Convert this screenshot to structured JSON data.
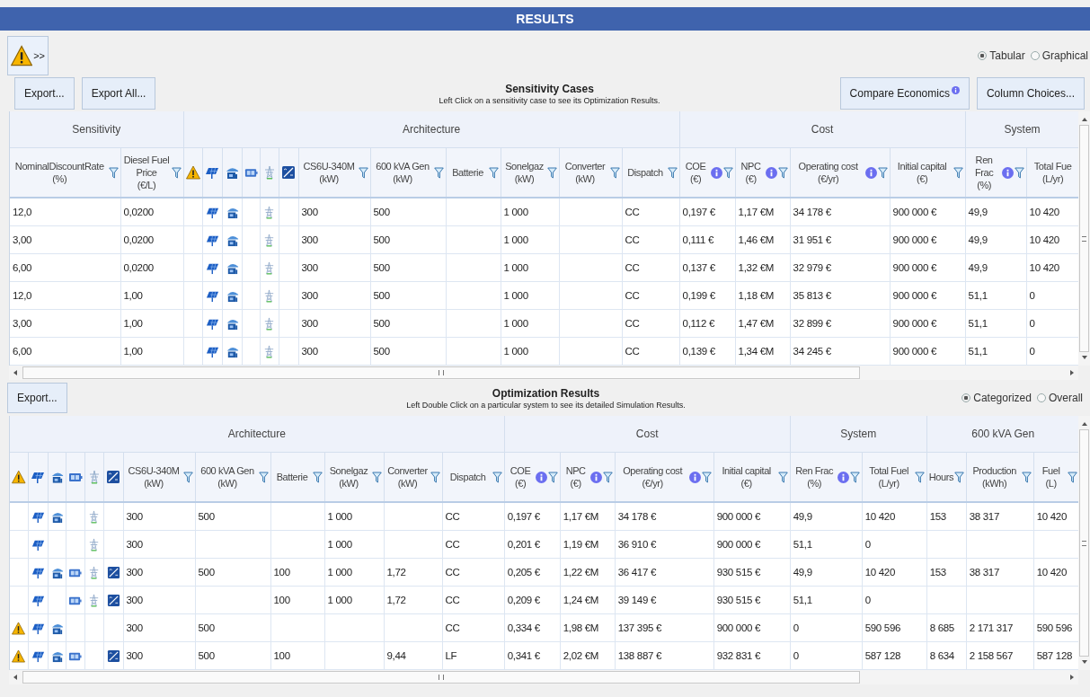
{
  "header": {
    "title": "RESULTS"
  },
  "warning_button": {
    "label": ">>"
  },
  "view_options": [
    {
      "label": "Tabular",
      "selected": true
    },
    {
      "label": "Graphical",
      "selected": false
    }
  ],
  "sensitivity": {
    "left_buttons": [
      "Export...",
      "Export All..."
    ],
    "title": "Sensitivity Cases",
    "hint": "Left Click on a sensitivity case to see its Optimization Results.",
    "right_buttons": [
      {
        "label": "Compare Economics",
        "info": true
      },
      {
        "label": "Column Choices...",
        "info": false
      }
    ],
    "groups": [
      {
        "label": "Sensitivity",
        "columns": [
          {
            "kind": "text",
            "label": "NominalDiscountRate",
            "unit": "(%)",
            "info": false,
            "filter": true
          },
          {
            "kind": "text",
            "label": "Diesel Fuel Price",
            "unit": "(€/L)",
            "info": false,
            "filter": true
          }
        ]
      },
      {
        "label": "Architecture",
        "columns": [
          {
            "kind": "warning",
            "info": false,
            "filter": false
          },
          {
            "kind": "panel",
            "info": false,
            "filter": false
          },
          {
            "kind": "generator",
            "info": false,
            "filter": false
          },
          {
            "kind": "battery",
            "info": false,
            "filter": false
          },
          {
            "kind": "tower",
            "info": false,
            "filter": false
          },
          {
            "kind": "converter",
            "info": false,
            "filter": false
          },
          {
            "kind": "text",
            "label": "CS6U-340M",
            "unit": "(kW)",
            "info": false,
            "filter": true
          },
          {
            "kind": "text",
            "label": "600 kVA Gen",
            "unit": "(kW)",
            "info": false,
            "filter": true
          },
          {
            "kind": "text",
            "label": "Batterie",
            "info": false,
            "filter": true
          },
          {
            "kind": "text",
            "label": "Sonelgaz",
            "unit": "(kW)",
            "info": false,
            "filter": true
          },
          {
            "kind": "text",
            "label": "Converter",
            "unit": "(kW)",
            "info": false,
            "filter": true
          },
          {
            "kind": "text",
            "label": "Dispatch",
            "info": false,
            "filter": true
          }
        ]
      },
      {
        "label": "Cost",
        "columns": [
          {
            "kind": "text",
            "label": "COE",
            "unit": "(€)",
            "info": true,
            "filter": true
          },
          {
            "kind": "text",
            "label": "NPC",
            "unit": "(€)",
            "info": true,
            "filter": true
          },
          {
            "kind": "text",
            "label": "Operating cost",
            "unit": "(€/yr)",
            "info": true,
            "filter": true
          },
          {
            "kind": "text",
            "label": "Initial capital",
            "unit": "(€)",
            "info": false,
            "filter": true
          }
        ]
      },
      {
        "label": "System",
        "columns": [
          {
            "kind": "text",
            "label": "Ren Frac",
            "unit": "(%)",
            "info": true,
            "filter": true
          },
          {
            "kind": "text",
            "label": "Total Fue",
            "unit": "(L/yr)",
            "info": false,
            "filter": false
          }
        ]
      }
    ],
    "rows": [
      {
        "cells": [
          {
            "kind": "text",
            "text": "12,0"
          },
          {
            "kind": "text",
            "text": "0,0200"
          },
          {
            "kind": "icon",
            "shown": false
          },
          {
            "kind": "icon",
            "shown": true
          },
          {
            "kind": "icon",
            "shown": true
          },
          {
            "kind": "icon",
            "shown": false
          },
          {
            "kind": "icon",
            "shown": true
          },
          {
            "kind": "icon",
            "shown": false
          },
          {
            "kind": "text",
            "text": "300"
          },
          {
            "kind": "text",
            "text": "500"
          },
          {
            "kind": "empty"
          },
          {
            "kind": "text",
            "text": "1 000"
          },
          {
            "kind": "empty"
          },
          {
            "kind": "text",
            "text": "CC"
          },
          {
            "kind": "text",
            "text": "0,197 €"
          },
          {
            "kind": "text",
            "text": "1,17 €M"
          },
          {
            "kind": "text",
            "text": "34 178 €"
          },
          {
            "kind": "text",
            "text": "900 000 €"
          },
          {
            "kind": "text",
            "text": "49,9"
          },
          {
            "kind": "text",
            "text": "10 420"
          }
        ]
      },
      {
        "cells": [
          {
            "kind": "text",
            "text": "3,00"
          },
          {
            "kind": "text",
            "text": "0,0200"
          },
          {
            "kind": "icon",
            "shown": false
          },
          {
            "kind": "icon",
            "shown": true
          },
          {
            "kind": "icon",
            "shown": true
          },
          {
            "kind": "icon",
            "shown": false
          },
          {
            "kind": "icon",
            "shown": true
          },
          {
            "kind": "icon",
            "shown": false
          },
          {
            "kind": "text",
            "text": "300"
          },
          {
            "kind": "text",
            "text": "500"
          },
          {
            "kind": "empty"
          },
          {
            "kind": "text",
            "text": "1 000"
          },
          {
            "kind": "empty"
          },
          {
            "kind": "text",
            "text": "CC"
          },
          {
            "kind": "text",
            "text": "0,111 €"
          },
          {
            "kind": "text",
            "text": "1,46 €M"
          },
          {
            "kind": "text",
            "text": "31 951 €"
          },
          {
            "kind": "text",
            "text": "900 000 €"
          },
          {
            "kind": "text",
            "text": "49,9"
          },
          {
            "kind": "text",
            "text": "10 420"
          }
        ]
      },
      {
        "cells": [
          {
            "kind": "text",
            "text": "6,00"
          },
          {
            "kind": "text",
            "text": "0,0200"
          },
          {
            "kind": "icon",
            "shown": false
          },
          {
            "kind": "icon",
            "shown": true
          },
          {
            "kind": "icon",
            "shown": true
          },
          {
            "kind": "icon",
            "shown": false
          },
          {
            "kind": "icon",
            "shown": true
          },
          {
            "kind": "icon",
            "shown": false
          },
          {
            "kind": "text",
            "text": "300"
          },
          {
            "kind": "text",
            "text": "500"
          },
          {
            "kind": "empty"
          },
          {
            "kind": "text",
            "text": "1 000"
          },
          {
            "kind": "empty"
          },
          {
            "kind": "text",
            "text": "CC"
          },
          {
            "kind": "text",
            "text": "0,137 €"
          },
          {
            "kind": "text",
            "text": "1,32 €M"
          },
          {
            "kind": "text",
            "text": "32 979 €"
          },
          {
            "kind": "text",
            "text": "900 000 €"
          },
          {
            "kind": "text",
            "text": "49,9"
          },
          {
            "kind": "text",
            "text": "10 420"
          }
        ]
      },
      {
        "cells": [
          {
            "kind": "text",
            "text": "12,0"
          },
          {
            "kind": "text",
            "text": "1,00"
          },
          {
            "kind": "icon",
            "shown": false
          },
          {
            "kind": "icon",
            "shown": true
          },
          {
            "kind": "icon",
            "shown": true
          },
          {
            "kind": "icon",
            "shown": false
          },
          {
            "kind": "icon",
            "shown": true
          },
          {
            "kind": "icon",
            "shown": false
          },
          {
            "kind": "text",
            "text": "300"
          },
          {
            "kind": "text",
            "text": "500"
          },
          {
            "kind": "empty"
          },
          {
            "kind": "text",
            "text": "1 000"
          },
          {
            "kind": "empty"
          },
          {
            "kind": "text",
            "text": "CC"
          },
          {
            "kind": "text",
            "text": "0,199 €"
          },
          {
            "kind": "text",
            "text": "1,18 €M"
          },
          {
            "kind": "text",
            "text": "35 813 €"
          },
          {
            "kind": "text",
            "text": "900 000 €"
          },
          {
            "kind": "text",
            "text": "51,1"
          },
          {
            "kind": "text",
            "text": "0"
          }
        ]
      },
      {
        "cells": [
          {
            "kind": "text",
            "text": "3,00"
          },
          {
            "kind": "text",
            "text": "1,00"
          },
          {
            "kind": "icon",
            "shown": false
          },
          {
            "kind": "icon",
            "shown": true
          },
          {
            "kind": "icon",
            "shown": true
          },
          {
            "kind": "icon",
            "shown": false
          },
          {
            "kind": "icon",
            "shown": true
          },
          {
            "kind": "icon",
            "shown": false
          },
          {
            "kind": "text",
            "text": "300"
          },
          {
            "kind": "text",
            "text": "500"
          },
          {
            "kind": "empty"
          },
          {
            "kind": "text",
            "text": "1 000"
          },
          {
            "kind": "empty"
          },
          {
            "kind": "text",
            "text": "CC"
          },
          {
            "kind": "text",
            "text": "0,112 €"
          },
          {
            "kind": "text",
            "text": "1,47 €M"
          },
          {
            "kind": "text",
            "text": "32 899 €"
          },
          {
            "kind": "text",
            "text": "900 000 €"
          },
          {
            "kind": "text",
            "text": "51,1"
          },
          {
            "kind": "text",
            "text": "0"
          }
        ]
      },
      {
        "cells": [
          {
            "kind": "text",
            "text": "6,00"
          },
          {
            "kind": "text",
            "text": "1,00"
          },
          {
            "kind": "icon",
            "shown": false
          },
          {
            "kind": "icon",
            "shown": true
          },
          {
            "kind": "icon",
            "shown": true
          },
          {
            "kind": "icon",
            "shown": false
          },
          {
            "kind": "icon",
            "shown": true
          },
          {
            "kind": "icon",
            "shown": false
          },
          {
            "kind": "text",
            "text": "300"
          },
          {
            "kind": "text",
            "text": "500"
          },
          {
            "kind": "empty"
          },
          {
            "kind": "text",
            "text": "1 000"
          },
          {
            "kind": "empty"
          },
          {
            "kind": "text",
            "text": "CC"
          },
          {
            "kind": "text",
            "text": "0,139 €"
          },
          {
            "kind": "text",
            "text": "1,34 €M"
          },
          {
            "kind": "text",
            "text": "34 245 €"
          },
          {
            "kind": "text",
            "text": "900 000 €"
          },
          {
            "kind": "text",
            "text": "51,1"
          },
          {
            "kind": "text",
            "text": "0"
          }
        ]
      }
    ]
  },
  "optimization": {
    "left_buttons": [
      "Export..."
    ],
    "title": "Optimization Results",
    "hint": "Left Double Click on a particular system to see its detailed Simulation Results.",
    "view_options": [
      {
        "label": "Categorized",
        "selected": true
      },
      {
        "label": "Overall",
        "selected": false
      }
    ],
    "groups": [
      {
        "label": "Architecture",
        "columns": [
          {
            "kind": "warning",
            "info": false,
            "filter": false
          },
          {
            "kind": "panel",
            "info": false,
            "filter": false
          },
          {
            "kind": "generator",
            "info": false,
            "filter": false
          },
          {
            "kind": "battery",
            "info": false,
            "filter": false
          },
          {
            "kind": "tower",
            "info": false,
            "filter": false
          },
          {
            "kind": "converter",
            "info": false,
            "filter": false
          },
          {
            "kind": "text",
            "label": "CS6U-340M",
            "unit": "(kW)",
            "info": false,
            "filter": true
          },
          {
            "kind": "text",
            "label": "600 kVA Gen",
            "unit": "(kW)",
            "info": false,
            "filter": true
          },
          {
            "kind": "text",
            "label": "Batterie",
            "info": false,
            "filter": true
          },
          {
            "kind": "text",
            "label": "Sonelgaz",
            "unit": "(kW)",
            "info": false,
            "filter": true
          },
          {
            "kind": "text",
            "label": "Converter",
            "unit": "(kW)",
            "info": false,
            "filter": true
          },
          {
            "kind": "text",
            "label": "Dispatch",
            "info": false,
            "filter": true
          }
        ]
      },
      {
        "label": "Cost",
        "columns": [
          {
            "kind": "text",
            "label": "COE",
            "unit": "(€)",
            "info": true,
            "filter": true
          },
          {
            "kind": "text",
            "label": "NPC",
            "unit": "(€)",
            "info": true,
            "filter": true
          },
          {
            "kind": "text",
            "label": "Operating cost",
            "unit": "(€/yr)",
            "info": true,
            "filter": true
          },
          {
            "kind": "text",
            "label": "Initial capital",
            "unit": "(€)",
            "info": false,
            "filter": true
          }
        ]
      },
      {
        "label": "System",
        "columns": [
          {
            "kind": "text",
            "label": "Ren Frac",
            "unit": "(%)",
            "info": true,
            "filter": true
          },
          {
            "kind": "text",
            "label": "Total Fuel",
            "unit": "(L/yr)",
            "info": false,
            "filter": true
          }
        ]
      },
      {
        "label": "600 kVA Gen",
        "columns": [
          {
            "kind": "text",
            "label": "Hours",
            "info": false,
            "filter": true
          },
          {
            "kind": "text",
            "label": "Production",
            "unit": "(kWh)",
            "info": false,
            "filter": true
          },
          {
            "kind": "text",
            "label": "Fuel",
            "unit": "(L)",
            "info": false,
            "filter": true
          }
        ]
      }
    ],
    "rows": [
      {
        "cells": [
          {
            "kind": "icon",
            "shown": false
          },
          {
            "kind": "icon",
            "shown": true
          },
          {
            "kind": "icon",
            "shown": true
          },
          {
            "kind": "icon",
            "shown": false
          },
          {
            "kind": "icon",
            "shown": true
          },
          {
            "kind": "icon",
            "shown": false
          },
          {
            "kind": "text",
            "text": "300"
          },
          {
            "kind": "text",
            "text": "500"
          },
          {
            "kind": "empty"
          },
          {
            "kind": "text",
            "text": "1 000"
          },
          {
            "kind": "empty"
          },
          {
            "kind": "text",
            "text": "CC"
          },
          {
            "kind": "text",
            "text": "0,197 €"
          },
          {
            "kind": "text",
            "text": "1,17 €M"
          },
          {
            "kind": "text",
            "text": "34 178 €"
          },
          {
            "kind": "text",
            "text": "900 000 €"
          },
          {
            "kind": "text",
            "text": "49,9"
          },
          {
            "kind": "text",
            "text": "10 420"
          },
          {
            "kind": "text",
            "text": "153"
          },
          {
            "kind": "text",
            "text": "38 317"
          },
          {
            "kind": "text",
            "text": "10 420"
          }
        ]
      },
      {
        "cells": [
          {
            "kind": "icon",
            "shown": false
          },
          {
            "kind": "icon",
            "shown": true
          },
          {
            "kind": "icon",
            "shown": false
          },
          {
            "kind": "icon",
            "shown": false
          },
          {
            "kind": "icon",
            "shown": true
          },
          {
            "kind": "icon",
            "shown": false
          },
          {
            "kind": "text",
            "text": "300"
          },
          {
            "kind": "empty"
          },
          {
            "kind": "empty"
          },
          {
            "kind": "text",
            "text": "1 000"
          },
          {
            "kind": "empty"
          },
          {
            "kind": "text",
            "text": "CC"
          },
          {
            "kind": "text",
            "text": "0,201 €"
          },
          {
            "kind": "text",
            "text": "1,19 €M"
          },
          {
            "kind": "text",
            "text": "36 910 €"
          },
          {
            "kind": "text",
            "text": "900 000 €"
          },
          {
            "kind": "text",
            "text": "51,1"
          },
          {
            "kind": "text",
            "text": "0"
          },
          {
            "kind": "empty"
          },
          {
            "kind": "empty"
          },
          {
            "kind": "empty"
          }
        ]
      },
      {
        "cells": [
          {
            "kind": "icon",
            "shown": false
          },
          {
            "kind": "icon",
            "shown": true
          },
          {
            "kind": "icon",
            "shown": true
          },
          {
            "kind": "icon",
            "shown": true
          },
          {
            "kind": "icon",
            "shown": true
          },
          {
            "kind": "icon",
            "shown": true
          },
          {
            "kind": "text",
            "text": "300"
          },
          {
            "kind": "text",
            "text": "500"
          },
          {
            "kind": "text",
            "text": "100"
          },
          {
            "kind": "text",
            "text": "1 000"
          },
          {
            "kind": "text",
            "text": "1,72"
          },
          {
            "kind": "text",
            "text": "CC"
          },
          {
            "kind": "text",
            "text": "0,205 €"
          },
          {
            "kind": "text",
            "text": "1,22 €M"
          },
          {
            "kind": "text",
            "text": "36 417 €"
          },
          {
            "kind": "text",
            "text": "930 515 €"
          },
          {
            "kind": "text",
            "text": "49,9"
          },
          {
            "kind": "text",
            "text": "10 420"
          },
          {
            "kind": "text",
            "text": "153"
          },
          {
            "kind": "text",
            "text": "38 317"
          },
          {
            "kind": "text",
            "text": "10 420"
          }
        ]
      },
      {
        "cells": [
          {
            "kind": "icon",
            "shown": false
          },
          {
            "kind": "icon",
            "shown": true
          },
          {
            "kind": "icon",
            "shown": false
          },
          {
            "kind": "icon",
            "shown": true
          },
          {
            "kind": "icon",
            "shown": true
          },
          {
            "kind": "icon",
            "shown": true
          },
          {
            "kind": "text",
            "text": "300"
          },
          {
            "kind": "empty"
          },
          {
            "kind": "text",
            "text": "100"
          },
          {
            "kind": "text",
            "text": "1 000"
          },
          {
            "kind": "text",
            "text": "1,72"
          },
          {
            "kind": "text",
            "text": "CC"
          },
          {
            "kind": "text",
            "text": "0,209 €"
          },
          {
            "kind": "text",
            "text": "1,24 €M"
          },
          {
            "kind": "text",
            "text": "39 149 €"
          },
          {
            "kind": "text",
            "text": "930 515 €"
          },
          {
            "kind": "text",
            "text": "51,1"
          },
          {
            "kind": "text",
            "text": "0"
          },
          {
            "kind": "empty"
          },
          {
            "kind": "empty"
          },
          {
            "kind": "empty"
          }
        ]
      },
      {
        "cells": [
          {
            "kind": "icon",
            "shown": true
          },
          {
            "kind": "icon",
            "shown": true
          },
          {
            "kind": "icon",
            "shown": true
          },
          {
            "kind": "icon",
            "shown": false
          },
          {
            "kind": "icon",
            "shown": false
          },
          {
            "kind": "icon",
            "shown": false
          },
          {
            "kind": "text",
            "text": "300"
          },
          {
            "kind": "text",
            "text": "500"
          },
          {
            "kind": "empty"
          },
          {
            "kind": "empty"
          },
          {
            "kind": "empty"
          },
          {
            "kind": "text",
            "text": "CC"
          },
          {
            "kind": "text",
            "text": "0,334 €"
          },
          {
            "kind": "text",
            "text": "1,98 €M"
          },
          {
            "kind": "text",
            "text": "137 395 €"
          },
          {
            "kind": "text",
            "text": "900 000 €"
          },
          {
            "kind": "text",
            "text": "0"
          },
          {
            "kind": "text",
            "text": "590 596"
          },
          {
            "kind": "text",
            "text": "8 685"
          },
          {
            "kind": "text",
            "text": "2 171 317"
          },
          {
            "kind": "text",
            "text": "590 596"
          }
        ]
      },
      {
        "cells": [
          {
            "kind": "icon",
            "shown": true
          },
          {
            "kind": "icon",
            "shown": true
          },
          {
            "kind": "icon",
            "shown": true
          },
          {
            "kind": "icon",
            "shown": true
          },
          {
            "kind": "icon",
            "shown": false
          },
          {
            "kind": "icon",
            "shown": true
          },
          {
            "kind": "text",
            "text": "300"
          },
          {
            "kind": "text",
            "text": "500"
          },
          {
            "kind": "text",
            "text": "100"
          },
          {
            "kind": "empty"
          },
          {
            "kind": "text",
            "text": "9,44"
          },
          {
            "kind": "text",
            "text": "LF"
          },
          {
            "kind": "text",
            "text": "0,341 €"
          },
          {
            "kind": "text",
            "text": "2,02 €M"
          },
          {
            "kind": "text",
            "text": "138 887 €"
          },
          {
            "kind": "text",
            "text": "932 831 €"
          },
          {
            "kind": "text",
            "text": "0"
          },
          {
            "kind": "text",
            "text": "587 128"
          },
          {
            "kind": "text",
            "text": "8 634"
          },
          {
            "kind": "text",
            "text": "2 158 567"
          },
          {
            "kind": "text",
            "text": "587 128"
          }
        ]
      }
    ]
  }
}
